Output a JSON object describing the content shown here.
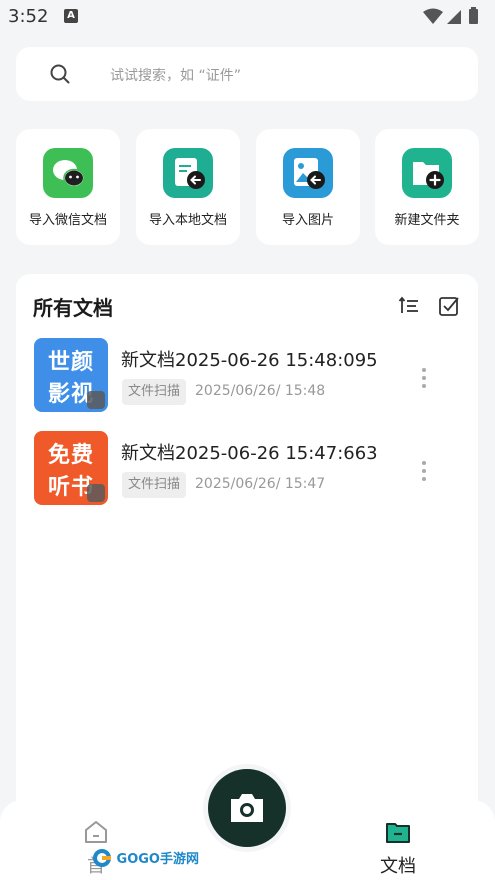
{
  "status_bar": {
    "time": "3:52",
    "notification": "A"
  },
  "search": {
    "placeholder": "试试搜索，如 “证件”"
  },
  "quick_actions": [
    {
      "label": "导入微信文档",
      "icon": "wechat-icon",
      "color": "#3dbf56"
    },
    {
      "label": "导入本地文档",
      "icon": "import-local-doc-icon",
      "color": "#1fae94"
    },
    {
      "label": "导入图片",
      "icon": "import-image-icon",
      "color": "#2b9bd8"
    },
    {
      "label": "新建文件夹",
      "icon": "new-folder-icon",
      "color": "#1fb48f"
    }
  ],
  "documents_panel": {
    "title": "所有文档"
  },
  "documents": [
    {
      "name": "新文档2025-06-26 15:48:095",
      "tag": "文件扫描",
      "date": "2025/06/26/ 15:48",
      "thumb_line1": "世颜",
      "thumb_line2": "影视",
      "thumb_color": "#3f8fe8"
    },
    {
      "name": "新文档2025-06-26 15:47:663",
      "tag": "文件扫描",
      "date": "2025/06/26/ 15:47",
      "thumb_line1": "免费",
      "thumb_line2": "听书",
      "thumb_color": "#f05a2a"
    }
  ],
  "bottom_nav": {
    "home_label": "首",
    "docs_label": "文档",
    "watermark": "GOGO手游网"
  },
  "colors": {
    "accent": "#1fb48f",
    "camera_button": "#16302a"
  }
}
